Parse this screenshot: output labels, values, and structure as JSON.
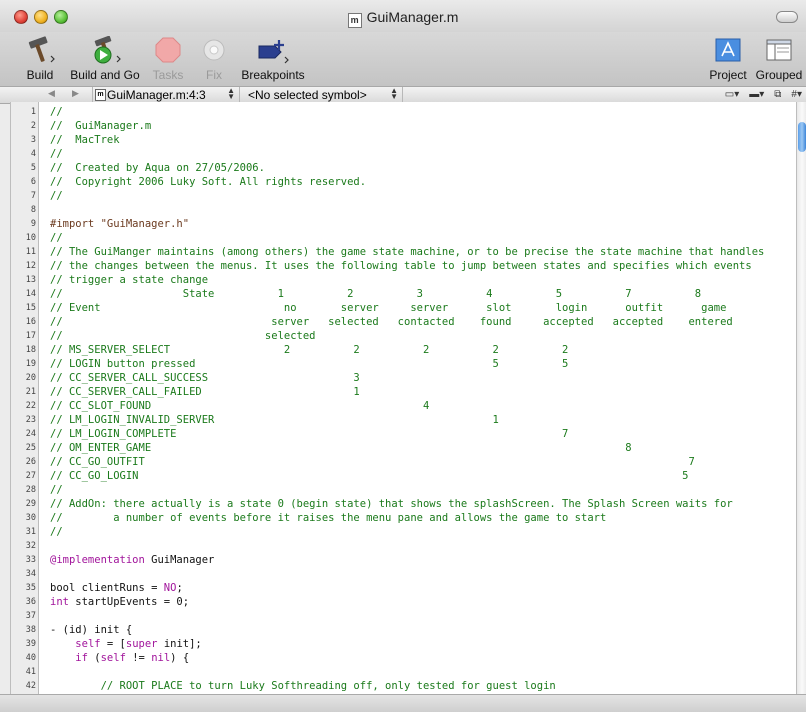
{
  "window": {
    "title": "GuiManager.m",
    "doc_icon": "m"
  },
  "toolbar": {
    "build": "Build",
    "build_and_go": "Build and Go",
    "tasks": "Tasks",
    "fix": "Fix",
    "breakpoints": "Breakpoints",
    "project": "Project",
    "grouped": "Grouped"
  },
  "navbar": {
    "file_location": "GuiManager.m:4:3",
    "file_icon": "m",
    "symbol": "<No selected symbol>"
  },
  "code_lines": [
    {
      "n": "1",
      "t": "//",
      "s": "comment"
    },
    {
      "n": "2",
      "t": "//  GuiManager.m",
      "s": "comment"
    },
    {
      "n": "3",
      "t": "//  MacTrek",
      "s": "comment"
    },
    {
      "n": "4",
      "t": "//",
      "s": "comment"
    },
    {
      "n": "5",
      "t": "//  Created by Aqua on 27/05/2006.",
      "s": "comment"
    },
    {
      "n": "6",
      "t": "//  Copyright 2006 Luky Soft. All rights reserved.",
      "s": "comment"
    },
    {
      "n": "7",
      "t": "//",
      "s": "comment"
    },
    {
      "n": "8",
      "t": "",
      "s": "code"
    },
    {
      "n": "9",
      "t": "#import \"GuiManager.h\"",
      "s": "pre"
    },
    {
      "n": "10",
      "t": "//",
      "s": "comment"
    },
    {
      "n": "11",
      "t": "// The GuiManger maintains (among others) the game state machine, or to be precise the state machine that handles",
      "s": "comment"
    },
    {
      "n": "12",
      "t": "// the changes between the menus. It uses the following table to jump between states and specifies which events",
      "s": "comment"
    },
    {
      "n": "13",
      "t": "// trigger a state change",
      "s": "comment"
    },
    {
      "n": "14",
      "t": "//                   State          1          2          3          4          5          7          8",
      "s": "comment"
    },
    {
      "n": "15",
      "t": "// Event                             no       server     server      slot       login      outfit      game",
      "s": "comment"
    },
    {
      "n": "16",
      "t": "//                                 server   selected   contacted    found     accepted   accepted    entered",
      "s": "comment"
    },
    {
      "n": "17",
      "t": "//                                selected",
      "s": "comment"
    },
    {
      "n": "18",
      "t": "// MS_SERVER_SELECT                  2          2          2          2          2",
      "s": "comment"
    },
    {
      "n": "19",
      "t": "// LOGIN button pressed                                               5          5",
      "s": "comment"
    },
    {
      "n": "20",
      "t": "// CC_SERVER_CALL_SUCCESS                       3",
      "s": "comment"
    },
    {
      "n": "21",
      "t": "// CC_SERVER_CALL_FAILED                        1",
      "s": "comment"
    },
    {
      "n": "22",
      "t": "// CC_SLOT_FOUND                                           4",
      "s": "comment"
    },
    {
      "n": "23",
      "t": "// LM_LOGIN_INVALID_SERVER                                            1",
      "s": "comment"
    },
    {
      "n": "24",
      "t": "// LM_LOGIN_COMPLETE                                                             7",
      "s": "comment"
    },
    {
      "n": "25",
      "t": "// OM_ENTER_GAME                                                                           8",
      "s": "comment"
    },
    {
      "n": "26",
      "t": "// CC_GO_OUTFIT                                                                                      7",
      "s": "comment"
    },
    {
      "n": "27",
      "t": "// CC_GO_LOGIN                                                                                      5",
      "s": "comment"
    },
    {
      "n": "28",
      "t": "//",
      "s": "comment"
    },
    {
      "n": "29",
      "t": "// AddOn: there actually is a state 0 (begin state) that shows the splashScreen. The Splash Screen waits for",
      "s": "comment"
    },
    {
      "n": "30",
      "t": "//        a number of events before it raises the menu pane and allows the game to start",
      "s": "comment"
    },
    {
      "n": "31",
      "t": "//",
      "s": "comment"
    },
    {
      "n": "32",
      "t": "",
      "s": "code"
    },
    {
      "n": "33",
      "t": "",
      "s": "code",
      "parts": [
        {
          "t": "@implementation",
          "s": "kw"
        },
        {
          "t": " GuiManager",
          "s": "code"
        }
      ]
    },
    {
      "n": "34",
      "t": "",
      "s": "code"
    },
    {
      "n": "35",
      "t": "",
      "s": "code",
      "parts": [
        {
          "t": "bool clientRuns = ",
          "s": "code"
        },
        {
          "t": "NO",
          "s": "kw"
        },
        {
          "t": ";",
          "s": "code"
        }
      ]
    },
    {
      "n": "36",
      "t": "",
      "s": "code",
      "parts": [
        {
          "t": "int",
          "s": "kw"
        },
        {
          "t": " startUpEvents = 0;",
          "s": "code"
        }
      ]
    },
    {
      "n": "37",
      "t": "",
      "s": "code"
    },
    {
      "n": "38",
      "t": "- (id) init {",
      "s": "code"
    },
    {
      "n": "39",
      "t": "",
      "s": "code",
      "parts": [
        {
          "t": "    ",
          "s": "code"
        },
        {
          "t": "self",
          "s": "kw"
        },
        {
          "t": " = [",
          "s": "code"
        },
        {
          "t": "super",
          "s": "kw"
        },
        {
          "t": " init];",
          "s": "code"
        }
      ]
    },
    {
      "n": "40",
      "t": "",
      "s": "code",
      "parts": [
        {
          "t": "    ",
          "s": "code"
        },
        {
          "t": "if",
          "s": "kw"
        },
        {
          "t": " (",
          "s": "code"
        },
        {
          "t": "self",
          "s": "kw"
        },
        {
          "t": " != ",
          "s": "code"
        },
        {
          "t": "nil",
          "s": "kw"
        },
        {
          "t": ") {",
          "s": "code"
        }
      ]
    },
    {
      "n": "41",
      "t": "",
      "s": "code"
    },
    {
      "n": "42",
      "t": "        // ROOT PLACE to turn Luky Softhreading off, only tested for guest login",
      "s": "comment"
    }
  ]
}
